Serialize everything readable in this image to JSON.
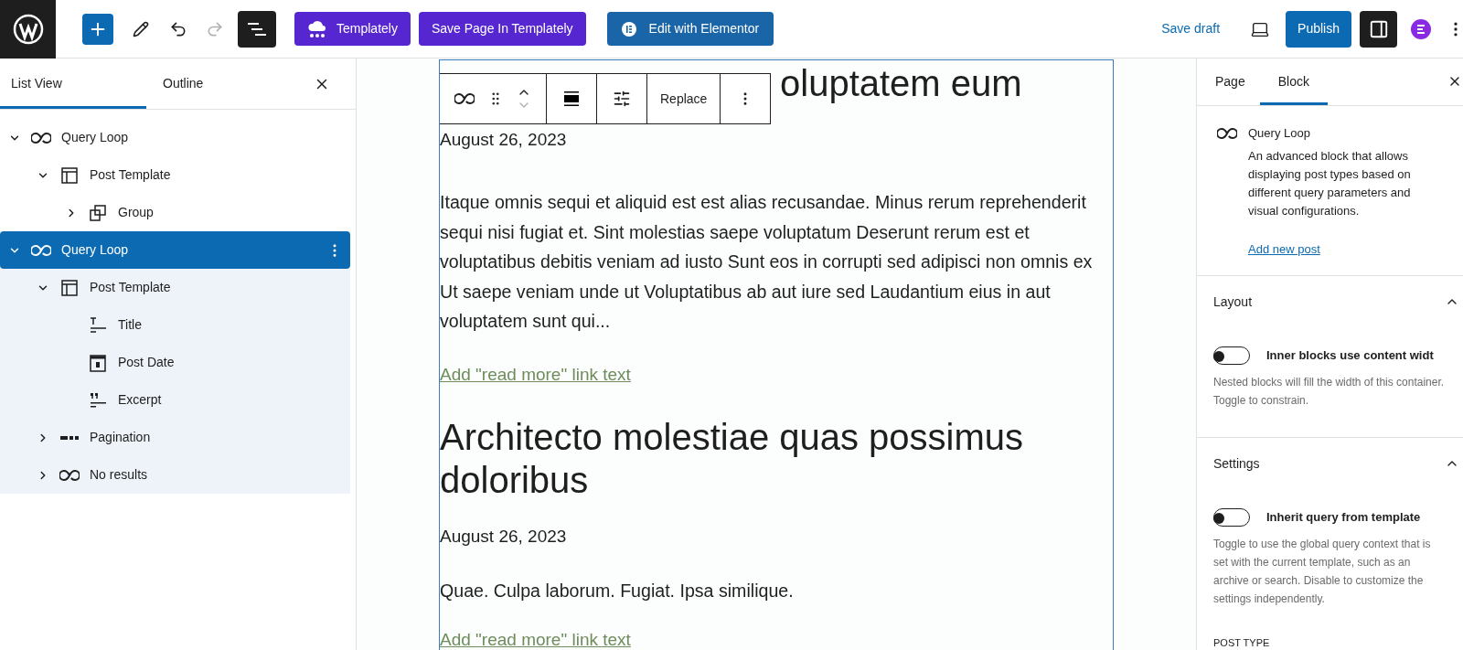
{
  "header": {
    "templately_button": "Templately",
    "save_templately_button": "Save Page In Templately",
    "elementor_button": "Edit with Elementor",
    "save_draft": "Save draft",
    "publish": "Publish"
  },
  "list_view": {
    "tabs": [
      {
        "label": "List View",
        "selected": true
      },
      {
        "label": "Outline",
        "selected": false
      }
    ],
    "tree": [
      {
        "label": "Query Loop",
        "kind": "loop",
        "expanded": true,
        "selected": false,
        "children": [
          {
            "label": "Post Template",
            "kind": "template",
            "expanded": true,
            "selected": false,
            "children": [
              {
                "label": "Group",
                "kind": "group",
                "expanded": false,
                "selected": false
              }
            ]
          }
        ]
      },
      {
        "label": "Query Loop",
        "kind": "loop",
        "expanded": true,
        "selected": true,
        "children": [
          {
            "label": "Post Template",
            "kind": "template",
            "expanded": true,
            "selected": false,
            "children": [
              {
                "label": "Title",
                "kind": "title",
                "selected": false
              },
              {
                "label": "Post Date",
                "kind": "date",
                "selected": false
              },
              {
                "label": "Excerpt",
                "kind": "excerpt",
                "selected": false
              }
            ]
          },
          {
            "label": "Pagination",
            "kind": "pagination",
            "expanded": false,
            "selected": false
          },
          {
            "label": "No results",
            "kind": "loop",
            "expanded": false,
            "selected": false
          }
        ]
      }
    ]
  },
  "block_toolbar": {
    "replace": "Replace"
  },
  "posts": [
    {
      "title": "oluptatem eum",
      "date": "August 26, 2023",
      "excerpt": "Itaque omnis sequi et aliquid est est alias recusandae. Minus rerum reprehenderit sequi nisi fugiat et. Sint molestias saepe voluptatum Deserunt rerum est et voluptatibus debitis veniam ad iusto Sunt eos in corrupti sed adipisci non omnis ex Ut saepe veniam unde ut Voluptatibus ab aut iure sed Laudantium eius in aut voluptatem sunt qui...",
      "read_more": "Add \"read more\" link text"
    },
    {
      "title": "Architecto molestiae quas possimus doloribus",
      "date": "August 26, 2023",
      "excerpt": "Quae. Culpa laborum. Fugiat. Ipsa similique.",
      "read_more": "Add \"read more\" link text"
    }
  ],
  "settings": {
    "tabs": [
      {
        "label": "Page",
        "selected": false
      },
      {
        "label": "Block",
        "selected": true
      }
    ],
    "block": {
      "title": "Query Loop",
      "description": "An advanced block that allows displaying post types based on different query parameters and visual configurations.",
      "link": "Add new post"
    },
    "panels": [
      {
        "title": "Layout",
        "expanded": true,
        "toggle": {
          "label": "Inner blocks use content widt",
          "on": false
        },
        "help": "Nested blocks will fill the width of this container. Toggle to constrain."
      },
      {
        "title": "Settings",
        "expanded": true,
        "toggle": {
          "label": "Inherit query from template",
          "on": false
        },
        "help": "Toggle to use the global query context that is set with the current template, such as an archive or search. Disable to customize the settings independently.",
        "field_label": "POST TYPE"
      }
    ]
  }
}
